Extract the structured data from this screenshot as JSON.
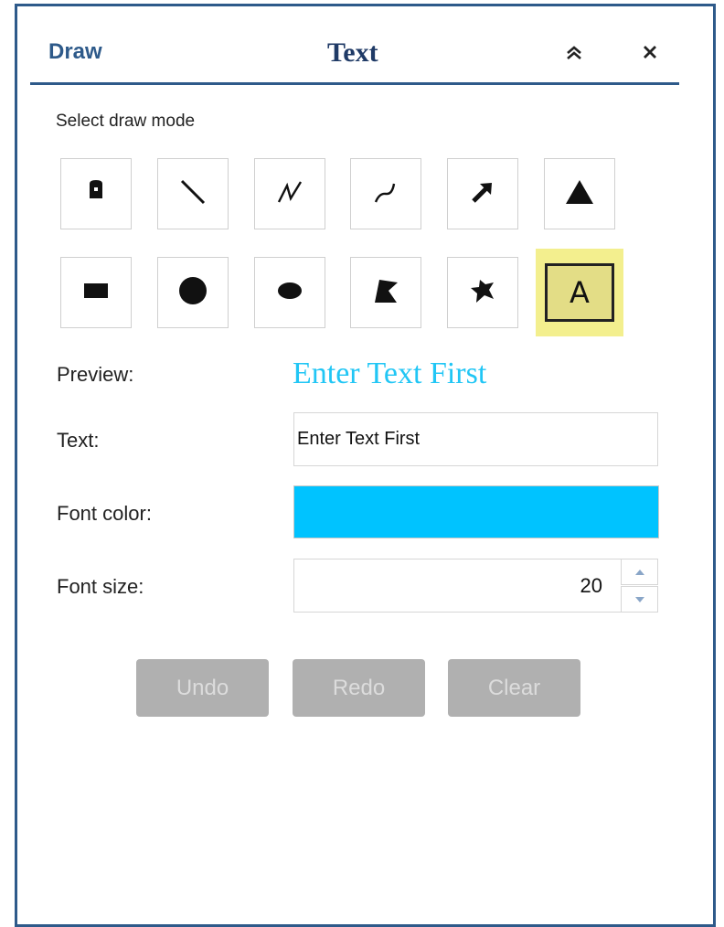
{
  "header": {
    "title": "Draw",
    "current_mode": "Text",
    "collapse_icon": "double-chevron-up-icon",
    "close_icon": "close-icon"
  },
  "draw_mode": {
    "label": "Select draw mode",
    "tools": [
      {
        "name": "point",
        "icon": "map-pin-icon"
      },
      {
        "name": "line",
        "icon": "line-icon"
      },
      {
        "name": "polyline",
        "icon": "polyline-icon"
      },
      {
        "name": "freehand-polyline",
        "icon": "freehand-line-icon"
      },
      {
        "name": "arrow",
        "icon": "arrow-icon"
      },
      {
        "name": "triangle",
        "icon": "triangle-icon"
      },
      {
        "name": "rectangle",
        "icon": "rectangle-icon"
      },
      {
        "name": "circle",
        "icon": "circle-icon"
      },
      {
        "name": "ellipse",
        "icon": "ellipse-icon"
      },
      {
        "name": "polygon",
        "icon": "polygon-icon"
      },
      {
        "name": "freehand-polygon",
        "icon": "freehand-polygon-icon"
      },
      {
        "name": "text",
        "icon": "text-icon",
        "glyph": "A",
        "active": true
      }
    ]
  },
  "form": {
    "preview_label": "Preview:",
    "preview_text": "Enter Text First",
    "text_label": "Text:",
    "text_value": "Enter Text First",
    "font_color_label": "Font color:",
    "font_color": "#00c3ff",
    "font_size_label": "Font size:",
    "font_size": "20"
  },
  "actions": {
    "undo": "Undo",
    "redo": "Redo",
    "clear": "Clear"
  },
  "colors": {
    "frame": "#2e5a8a",
    "active_tool": "#f3ef8e",
    "disabled_button": "#b0b0b0"
  }
}
